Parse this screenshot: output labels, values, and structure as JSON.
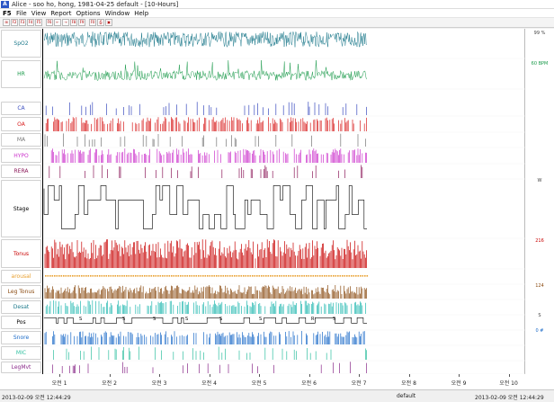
{
  "window": {
    "app_icon": "A",
    "title": "Alice - soo ho, hong, 1981-04-25 default - [10-Hours]"
  },
  "menubar": {
    "logo": "F5",
    "items": [
      "File",
      "View",
      "Report",
      "Options",
      "Window",
      "Help"
    ]
  },
  "toolbar": {
    "buttons": [
      {
        "icon": "open-icon",
        "label": "⊞"
      },
      {
        "icon": "f-icon",
        "label": "F2"
      },
      {
        "icon": "f-icon",
        "label": "F3"
      },
      {
        "icon": "f-icon",
        "label": "F4"
      },
      {
        "icon": "f-icon",
        "label": "F5"
      },
      {
        "icon": "f-icon",
        "label": "F6"
      },
      {
        "icon": "arrow-left-icon",
        "label": "←"
      },
      {
        "icon": "arrow-right-icon",
        "label": "→"
      },
      {
        "icon": "f-icon",
        "label": "F8"
      },
      {
        "icon": "f-icon",
        "label": "F9"
      },
      {
        "icon": "f-icon",
        "label": "F0"
      },
      {
        "icon": "print-icon",
        "label": "⎙"
      },
      {
        "icon": "save-icon",
        "label": "▣"
      }
    ]
  },
  "channels": [
    {
      "name": "SpO2",
      "color": "#1e7a8c",
      "type": "dense-line"
    },
    {
      "name": "HR",
      "color": "#1a9a4a",
      "type": "line"
    },
    {
      "name": "CA",
      "color": "#3b4dbf",
      "type": "sparse"
    },
    {
      "name": "OA",
      "color": "#d81e1e",
      "type": "bars"
    },
    {
      "name": "MA",
      "color": "#777777",
      "type": "sparse"
    },
    {
      "name": "HYPO",
      "color": "#cc33cc",
      "type": "bars"
    },
    {
      "name": "RERA",
      "color": "#8b1a5a",
      "type": "sparse"
    },
    {
      "name": "Stage",
      "color": "#000000",
      "type": "step"
    },
    {
      "name": "Tonus",
      "color": "#c80000",
      "type": "dense-bars"
    },
    {
      "name": "arousal",
      "color": "#e8a030",
      "type": "dots"
    },
    {
      "name": "Leg Tonus",
      "color": "#8a4a10",
      "type": "dense-bars"
    },
    {
      "name": "Desat",
      "color": "#22b8b0",
      "type": "bars"
    },
    {
      "name": "Pos",
      "color": "#000000",
      "type": "step"
    },
    {
      "name": "Snore",
      "color": "#1a6ac8",
      "type": "bars"
    },
    {
      "name": "MIC",
      "color": "#30c0a0",
      "type": "sparse"
    },
    {
      "name": "LegMvt",
      "color": "#8a2a8a",
      "type": "sparse"
    }
  ],
  "channel_label_colors": [
    "#1e7a8c",
    "#1a9a4a",
    "#3b4dbf",
    "#d81e1e",
    "#777777",
    "#cc33cc",
    "#8b1a5a",
    "#000000",
    "#c80000",
    "#e8a030",
    "#8a4a10",
    "#1e7a8c",
    "#000000",
    "#1a6ac8",
    "#30c0a0",
    "#8a2a8a"
  ],
  "scale_labels": {
    "spo2": "99 %",
    "hr": "60 BPM",
    "stage": "W",
    "tonus": "216",
    "leg_tonus": "124",
    "pos": "S",
    "snore": "0 #"
  },
  "time_axis": [
    "오전 1",
    "오전 2",
    "오전 3",
    "오전 4",
    "오전 5",
    "오전 6",
    "오전 7",
    "오전 8",
    "오전 9",
    "오전 10"
  ],
  "statusbar": {
    "left_time": "2013-02-09 오전 12:44:29",
    "center": "default",
    "right_time": "2013-02-09 오전 12:44:29"
  },
  "pos_markers": [
    "S",
    "S",
    "S",
    "S",
    "S",
    "S",
    "R",
    "S"
  ]
}
